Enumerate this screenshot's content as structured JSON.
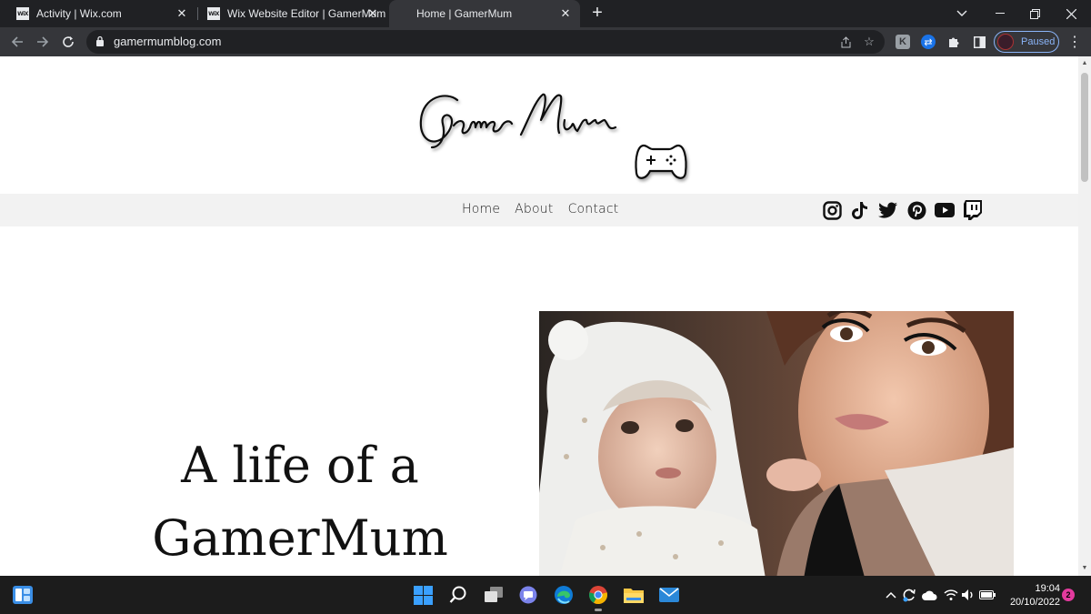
{
  "browser": {
    "tabs": [
      {
        "title": "Activity | Wix.com",
        "favicon": "WiX",
        "active": false
      },
      {
        "title": "Wix Website Editor | GamerMum",
        "favicon": "WiX",
        "active": false
      },
      {
        "title": "Home | GamerMum",
        "favicon": "",
        "active": true
      }
    ],
    "url": "gamermumblog.com",
    "profile_label": "Paused",
    "accent": "#8ab4f8"
  },
  "site": {
    "logo_text": "GamerMum",
    "nav": [
      "Home",
      "About",
      "Contact"
    ],
    "social": [
      "instagram-icon",
      "tiktok-icon",
      "twitter-icon",
      "pinterest-icon",
      "youtube-icon",
      "twitch-icon"
    ],
    "hero_line1": "A life of a",
    "hero_line2": "GamerMum",
    "nav_bg": "#f2f2f2"
  },
  "taskbar": {
    "time": "19:04",
    "date": "20/10/2022",
    "notifications": "2",
    "apps": [
      "start-icon",
      "search-icon",
      "task-view-icon",
      "teams-chat-icon",
      "edge-icon",
      "chrome-icon",
      "file-explorer-icon",
      "mail-icon"
    ]
  }
}
